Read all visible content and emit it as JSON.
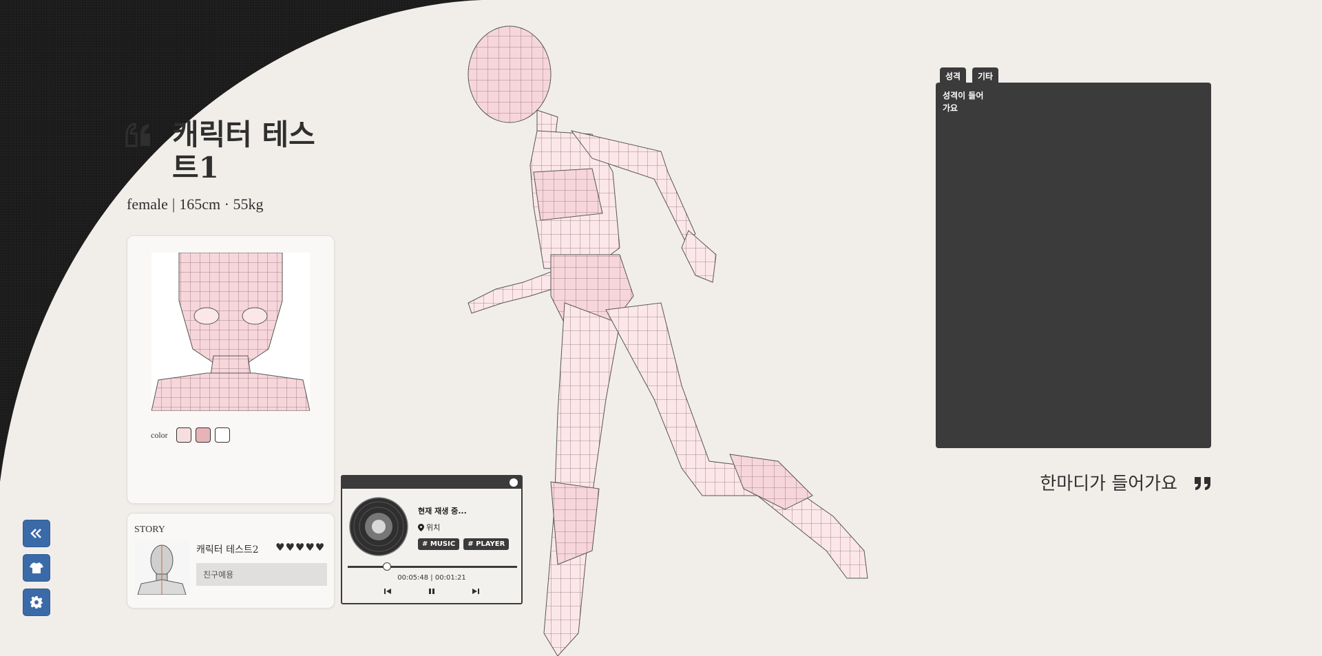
{
  "profile": {
    "name": "캐릭터 테스트1",
    "gender": "female",
    "separator": "|",
    "stats": "165cm · 55kg"
  },
  "colors": {
    "label": "color",
    "swatches": [
      "#f7dede",
      "#e8b3b8",
      "#ffffff"
    ],
    "accent": "#3b6aa8",
    "panel": "#3b3b3b",
    "background": "#f1eeea"
  },
  "story": {
    "label": "STORY",
    "name": "캐릭터 테스트2",
    "hearts": "♥♥♥♥♥",
    "relation": "친구예용"
  },
  "player": {
    "now_playing": "현재 재생 중...",
    "track": "위치",
    "tags": [
      "# MUSIC",
      "# PLAYER"
    ],
    "time": "00:05:48 | 00:01:21",
    "progress": 0.23
  },
  "sidebar": {
    "buttons": [
      {
        "name": "collapse",
        "icon": "double-chevron-left-icon"
      },
      {
        "name": "outfit",
        "icon": "tshirt-icon"
      },
      {
        "name": "settings",
        "icon": "gear-icon"
      }
    ]
  },
  "panel": {
    "tabs": [
      "성격",
      "기타"
    ],
    "text": "성격이 들어가요"
  },
  "quote": {
    "text": "한마디가 들어가요"
  }
}
